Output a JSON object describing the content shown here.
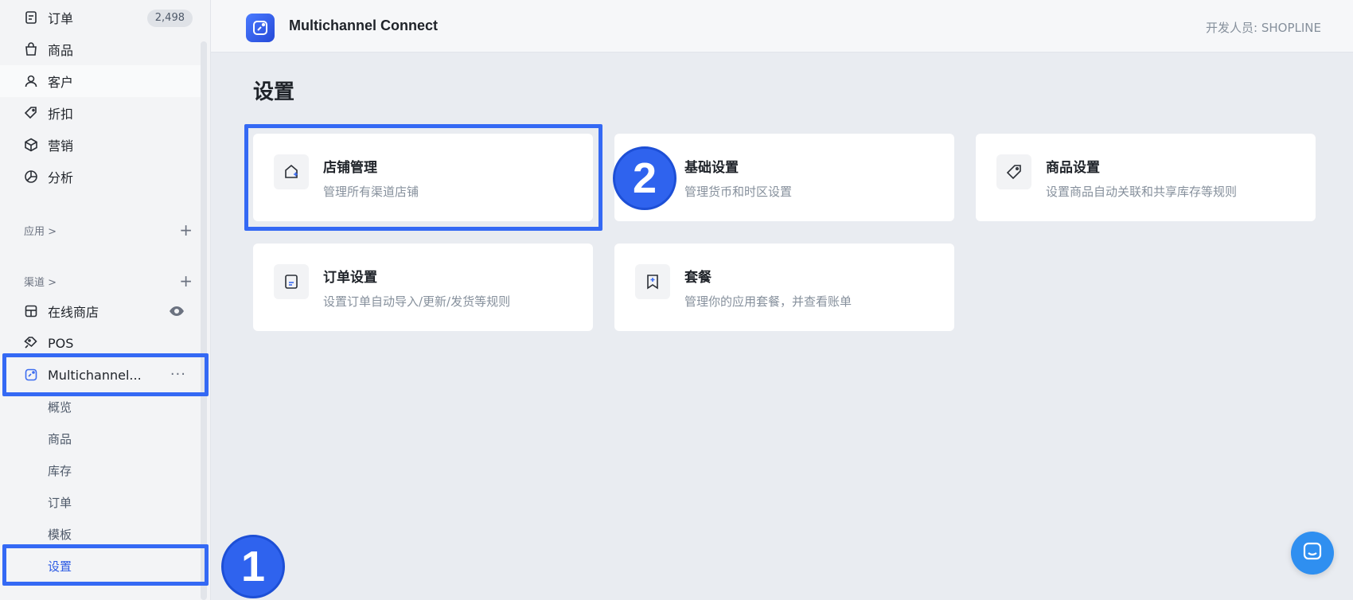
{
  "sidebar": {
    "items": [
      {
        "label": "订单",
        "icon": "order-icon",
        "badge": "2,498"
      },
      {
        "label": "商品",
        "icon": "bag-icon"
      },
      {
        "label": "客户",
        "icon": "user-icon"
      },
      {
        "label": "折扣",
        "icon": "tag-icon"
      },
      {
        "label": "营销",
        "icon": "box-icon"
      },
      {
        "label": "分析",
        "icon": "pie-chart-icon"
      }
    ],
    "apps_section": {
      "label": "应用 >",
      "add": "+"
    },
    "channels_section": {
      "label": "渠道 >",
      "add": "+"
    },
    "channels": [
      {
        "label": "在线商店",
        "icon": "store-icon"
      },
      {
        "label": "POS",
        "icon": "pos-tag-icon"
      },
      {
        "label": "Multichannel...",
        "icon": "multichannel-icon",
        "more": "···"
      }
    ],
    "sub_items": [
      "概览",
      "商品",
      "库存",
      "订单",
      "模板",
      "设置"
    ]
  },
  "header": {
    "app_title": "Multichannel Connect",
    "developer": "开发人员: SHOPLINE"
  },
  "main": {
    "page_title": "设置",
    "cards": [
      {
        "title": "店铺管理",
        "desc": "管理所有渠道店铺",
        "icon": "store-plus-icon"
      },
      {
        "title": "基础设置",
        "desc": "管理货币和时区设置",
        "icon": "settings-icon"
      },
      {
        "title": "商品设置",
        "desc": "设置商品自动关联和共享库存等规则",
        "icon": "tag-icon"
      },
      {
        "title": "订单设置",
        "desc": "设置订单自动导入/更新/发货等规则",
        "icon": "order-doc-icon"
      },
      {
        "title": "套餐",
        "desc": "管理你的应用套餐，并查看账单",
        "icon": "bookmark-plus-icon"
      }
    ]
  },
  "annotations": {
    "step1": "1",
    "step2": "2"
  },
  "colors": {
    "accent": "#3469f4",
    "step_badge": "#2f63ee",
    "chat": "#2f8ff0"
  }
}
